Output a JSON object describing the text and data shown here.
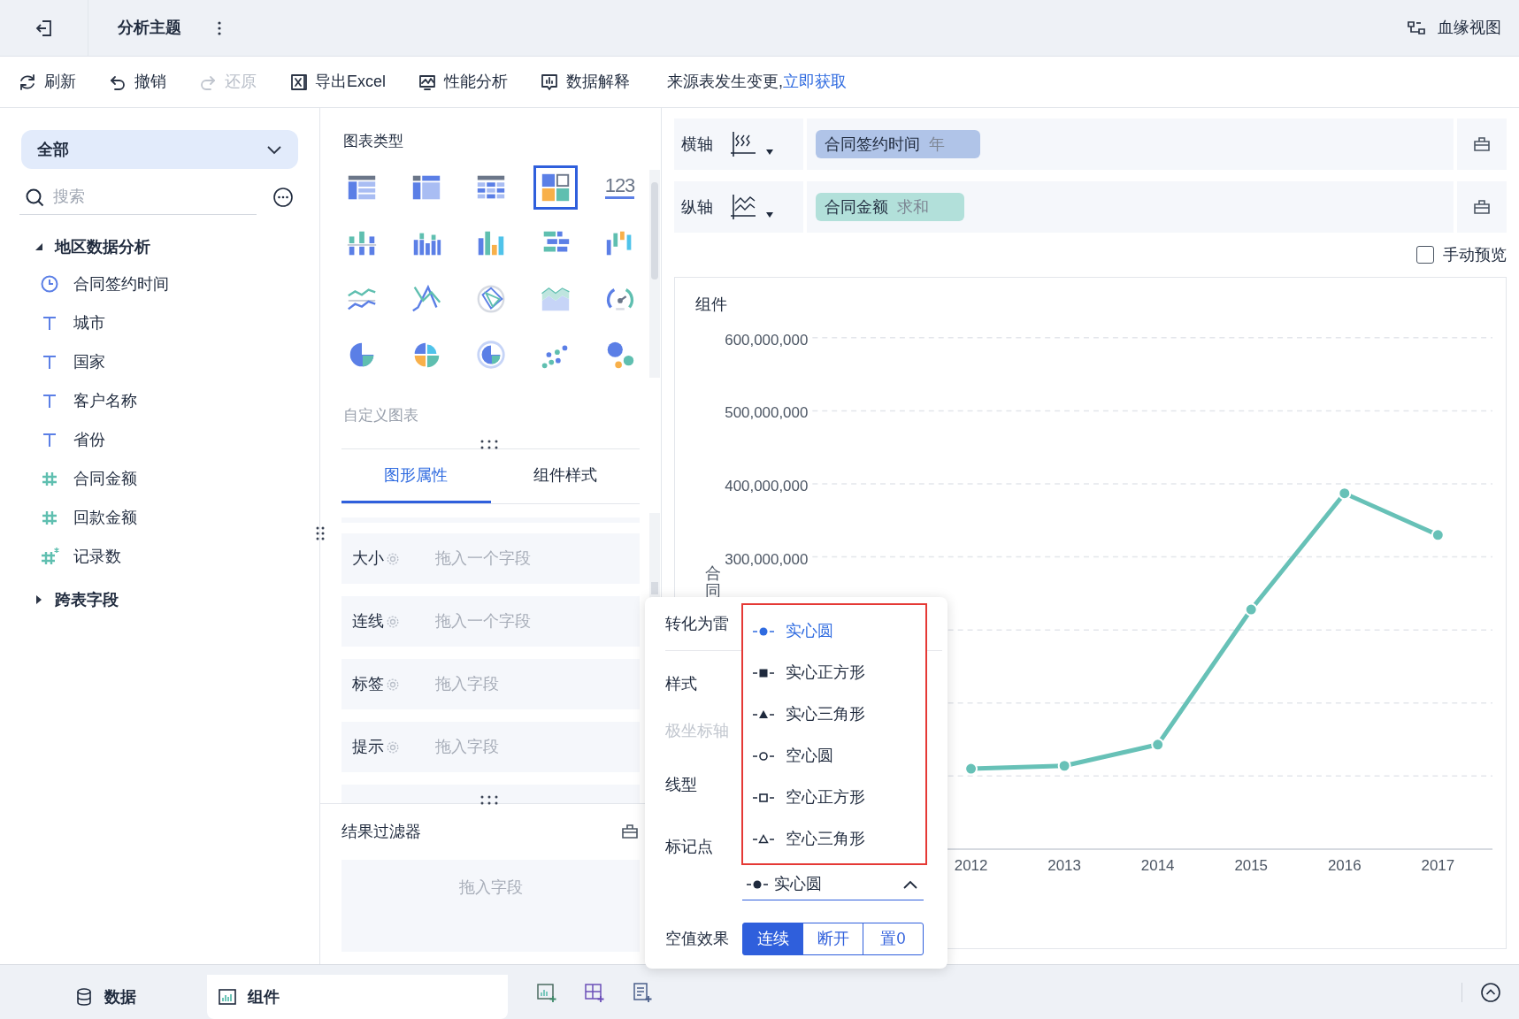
{
  "header": {
    "title": "分析主题",
    "lineage_button": "血缘视图"
  },
  "toolbar": [
    {
      "kind": "refresh",
      "label": "刷新",
      "disabled": false
    },
    {
      "kind": "undo",
      "label": "撤销",
      "disabled": false
    },
    {
      "kind": "redo",
      "label": "还原",
      "disabled": true
    },
    {
      "kind": "export",
      "label": "导出Excel",
      "disabled": false
    },
    {
      "kind": "performance",
      "label": "性能分析",
      "disabled": false
    },
    {
      "kind": "explain",
      "label": "数据解释",
      "disabled": false
    }
  ],
  "notice": {
    "text": "来源表发生变更,",
    "link": "立即获取"
  },
  "field_panel": {
    "scope": "全部",
    "search": {
      "placeholder": "搜索"
    },
    "tree": [
      {
        "label": "地区数据分析",
        "expanded": true,
        "children": [
          {
            "label": "合同签约时间",
            "kind": "date"
          },
          {
            "label": "城市",
            "kind": "text"
          },
          {
            "label": "国家",
            "kind": "text"
          },
          {
            "label": "客户名称",
            "kind": "text"
          },
          {
            "label": "省份",
            "kind": "text"
          },
          {
            "label": "合同金额",
            "kind": "number"
          },
          {
            "label": "回款金额",
            "kind": "number"
          },
          {
            "label": "记录数",
            "kind": "count"
          }
        ]
      },
      {
        "label": "跨表字段",
        "expanded": false
      }
    ]
  },
  "chart_types": {
    "title": "图表类型",
    "items": [
      {
        "kind": "cross-table",
        "selected": false
      },
      {
        "kind": "group-table",
        "selected": false
      },
      {
        "kind": "detail-table",
        "selected": false
      },
      {
        "kind": "dashboard",
        "selected": true
      },
      {
        "kind": "kpi",
        "label": "123",
        "selected": false
      },
      {
        "kind": "stacked-bar",
        "selected": false
      },
      {
        "kind": "multi-bar",
        "selected": false
      },
      {
        "kind": "bar",
        "selected": false
      },
      {
        "kind": "horizontal-bar",
        "selected": false
      },
      {
        "kind": "waterfall",
        "selected": false
      },
      {
        "kind": "line",
        "selected": false
      },
      {
        "kind": "cross-line",
        "selected": false
      },
      {
        "kind": "radar",
        "selected": false
      },
      {
        "kind": "area",
        "selected": false
      },
      {
        "kind": "gauge",
        "selected": false
      },
      {
        "kind": "pie",
        "selected": false
      },
      {
        "kind": "rose",
        "selected": false
      },
      {
        "kind": "ring",
        "selected": false
      },
      {
        "kind": "scatter",
        "selected": false
      },
      {
        "kind": "bubble",
        "selected": false
      }
    ]
  },
  "custom_charts": {
    "title": "自定义图表"
  },
  "property_tabs": [
    {
      "label": "图形属性",
      "selected": true
    },
    {
      "label": "组件样式",
      "selected": false
    }
  ],
  "properties": [
    {
      "label": "大小",
      "placeholder": "拖入一个字段"
    },
    {
      "label": "连线",
      "placeholder": "拖入一个字段"
    },
    {
      "label": "标签",
      "placeholder": "拖入字段"
    },
    {
      "label": "提示",
      "placeholder": "拖入字段"
    }
  ],
  "result_filter": {
    "title": "结果过滤器",
    "placeholder": "拖入字段"
  },
  "axes": [
    {
      "kind": "x",
      "label": "横轴",
      "field": "合同签约时间",
      "aggregation": "年",
      "color": "#b0c4e8"
    },
    {
      "kind": "y",
      "label": "纵轴",
      "field": "合同金额",
      "aggregation": "求和",
      "color": "#b2e0da"
    }
  ],
  "manual_preview": {
    "label": "手动预览",
    "checked": false
  },
  "chart": {
    "chart_data": {
      "type": "line",
      "title": "组件",
      "ylabel": "合同",
      "categories": [
        "2012",
        "2013",
        "2014",
        "2015",
        "2016",
        "2017"
      ],
      "grid": true,
      "series": [
        {
          "color": "#67c1b7",
          "marker": "circle",
          "values": [
            10000000,
            14000000,
            43000000,
            228000000,
            387000000,
            330000000
          ]
        }
      ],
      "ylim": [
        -100000000,
        600000000
      ],
      "yticks": [
        {
          "value": 300000000,
          "label": "300,000,000"
        },
        {
          "value": 400000000,
          "label": "400,000,000"
        },
        {
          "value": 500000000,
          "label": "500,000,000"
        },
        {
          "value": 600000000,
          "label": "600,000,000"
        }
      ]
    }
  },
  "popup": {
    "rows": [
      {
        "label": "转化为雷",
        "disabled": false
      },
      {
        "label": "样式",
        "disabled": false
      },
      {
        "label": "极坐标轴",
        "disabled": true
      },
      {
        "label": "线型",
        "disabled": false
      },
      {
        "label": "标记点",
        "disabled": false
      }
    ],
    "marker_select": {
      "kind": "solid-circle",
      "label": "实心圆",
      "expanded": true
    },
    "marker_options": [
      {
        "kind": "solid-circle",
        "label": "实心圆",
        "selected": true
      },
      {
        "kind": "solid-square",
        "label": "实心正方形",
        "selected": false
      },
      {
        "kind": "solid-triangle",
        "label": "实心三角形",
        "selected": false
      },
      {
        "kind": "hollow-circle",
        "label": "空心圆",
        "selected": false
      },
      {
        "kind": "hollow-square",
        "label": "空心正方形",
        "selected": false
      },
      {
        "kind": "hollow-triangle",
        "label": "空心三角形",
        "selected": false
      }
    ],
    "null_effect": {
      "label": "空值效果",
      "options": [
        {
          "label": "连续",
          "selected": true
        },
        {
          "label": "断开",
          "selected": false
        },
        {
          "label": "置0",
          "selected": false
        }
      ]
    }
  },
  "bottom_tabs": [
    {
      "kind": "data",
      "label": "数据",
      "selected": false
    },
    {
      "kind": "component",
      "label": "组件",
      "selected": true
    }
  ]
}
